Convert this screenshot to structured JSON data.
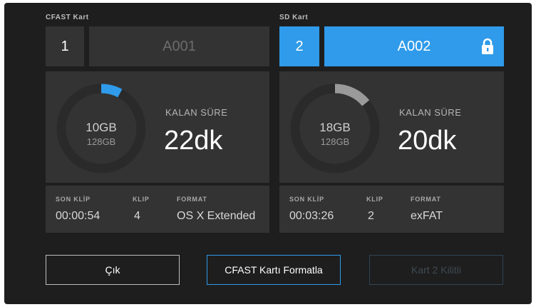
{
  "cards": [
    {
      "title": "CFAST Kart",
      "slot": "1",
      "name": "A001",
      "active": false,
      "locked": false,
      "used": "10GB",
      "total": "128GB",
      "used_fraction": 0.078,
      "remaining_label": "KALAN SÜRE",
      "remaining_value": "22dk",
      "info": {
        "last_clip_label": "SON KLİP",
        "last_clip_value": "00:00:54",
        "clip_label": "KLIP",
        "clip_value": "4",
        "format_label": "FORMAT",
        "format_value": "OS X Extended"
      }
    },
    {
      "title": "SD Kart",
      "slot": "2",
      "name": "A002",
      "active": true,
      "locked": true,
      "used": "18GB",
      "total": "128GB",
      "used_fraction": 0.14,
      "remaining_label": "KALAN SÜRE",
      "remaining_value": "20dk",
      "info": {
        "last_clip_label": "SON KLİP",
        "last_clip_value": "00:03:26",
        "clip_label": "KLIP",
        "clip_value": "2",
        "format_label": "FORMAT",
        "format_value": "exFAT"
      }
    }
  ],
  "buttons": {
    "exit": "Çık",
    "format": "CFAST Kartı Formatla",
    "locked": "Kart 2 Kilitli"
  },
  "colors": {
    "accent": "#2f9bea",
    "ring_used_card1": "#2f9bea",
    "ring_used_card2": "#9a9a9a",
    "ring_track": "#2a2a2a",
    "panel": "#333333",
    "background": "#1e1e1e"
  },
  "icons": {
    "lock": "lock-icon"
  }
}
